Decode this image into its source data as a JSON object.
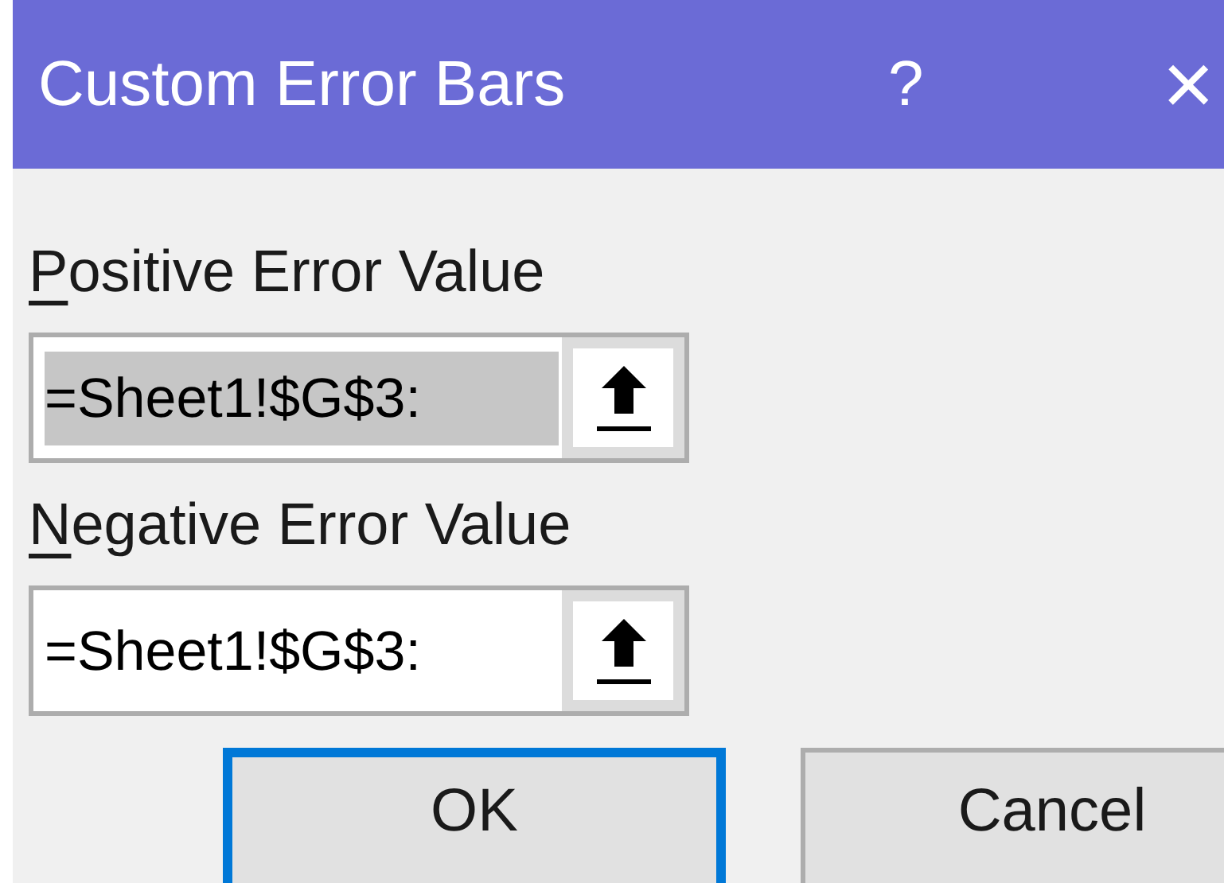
{
  "window": {
    "title": "Custom Error Bars",
    "help": "?",
    "close": "×"
  },
  "fields": [
    {
      "label": "Positive Error Value",
      "access_key_underlined": true,
      "value": "=Sheet1!$G$3:",
      "selected": true
    },
    {
      "label": "Negative Error Value",
      "access_key_underlined": true,
      "value": "=Sheet1!$G$3:",
      "selected": false
    }
  ],
  "buttons": [
    {
      "label": "OK",
      "default": true
    },
    {
      "label": "Cancel",
      "default": false
    }
  ]
}
